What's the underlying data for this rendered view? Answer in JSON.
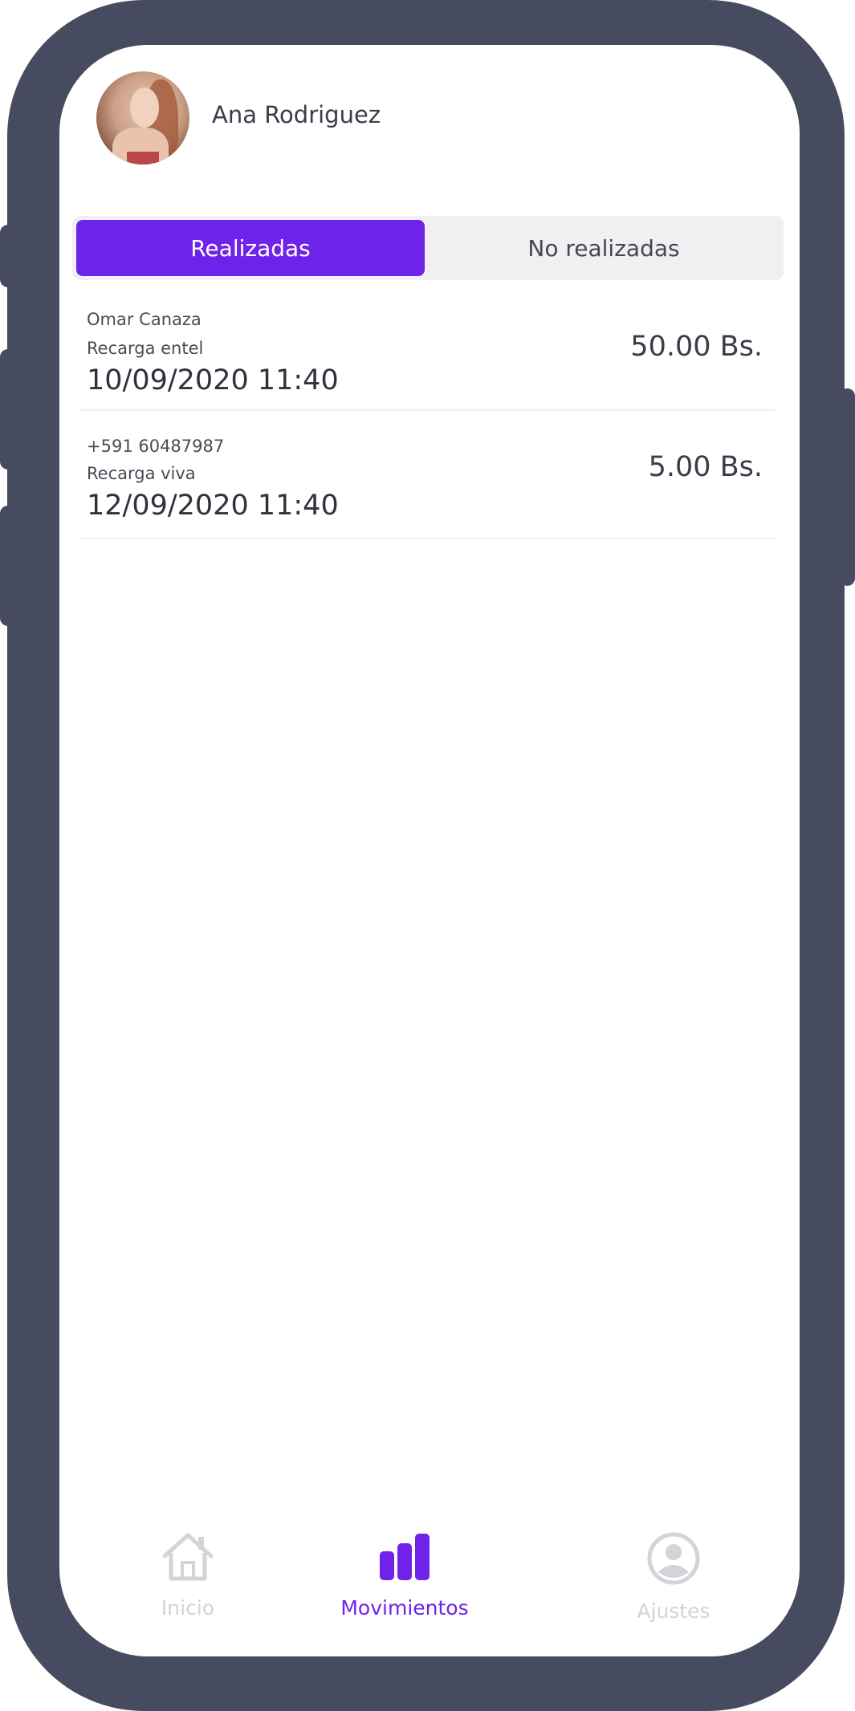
{
  "user": {
    "name": "Ana Rodriguez"
  },
  "tabs": [
    {
      "label": "Realizadas",
      "active": true
    },
    {
      "label": "No realizadas",
      "active": false
    }
  ],
  "transactions": [
    {
      "name": "Omar Canaza",
      "description": "Recarga entel",
      "datetime": "10/09/2020 11:40",
      "amount": "50.00 Bs."
    },
    {
      "name": "+591 60487987",
      "description": "Recarga viva",
      "datetime": "12/09/2020 11:40",
      "amount": "5.00 Bs."
    }
  ],
  "nav": [
    {
      "label": "Inicio",
      "icon": "home-icon",
      "active": false
    },
    {
      "label": "Movimientos",
      "icon": "bar-chart-icon",
      "active": true
    },
    {
      "label": "Ajustes",
      "icon": "user-circle-icon",
      "active": false
    }
  ],
  "colors": {
    "accent": "#6f22ea",
    "frame": "#474b5f",
    "inactive": "#d3d3d8"
  }
}
